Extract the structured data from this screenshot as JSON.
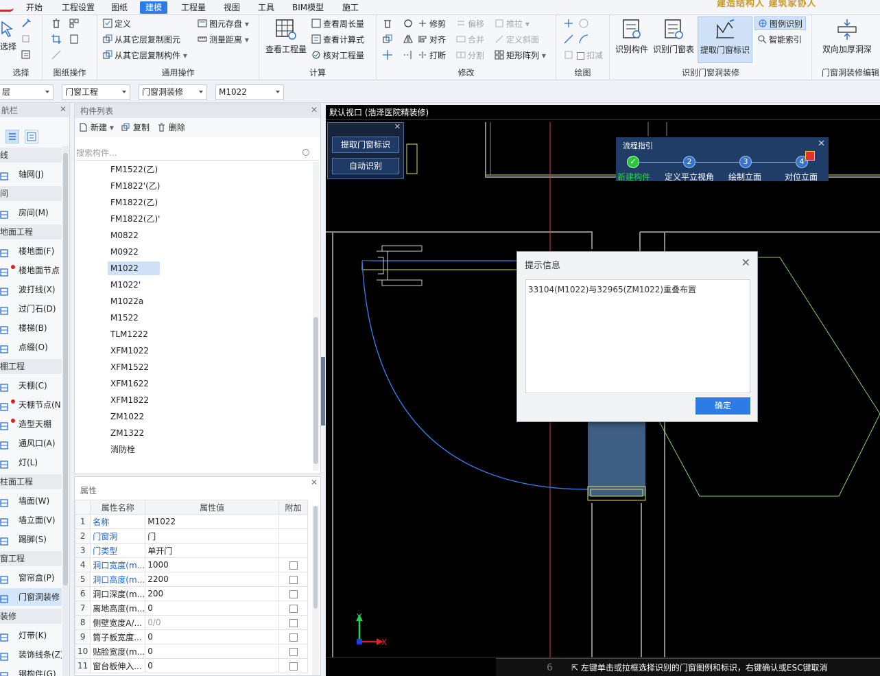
{
  "menubar": {
    "items": [
      "开始",
      "工程设置",
      "图纸",
      "建模",
      "工程量",
      "视图",
      "工具",
      "BIM模型",
      "施工"
    ],
    "active_index": 3,
    "promo": "建造结构人 建筑家协人"
  },
  "ribbon": {
    "select": {
      "caption": "选择",
      "large": "选择"
    },
    "drawing_ops": {
      "caption": "图纸操作"
    },
    "general_ops": {
      "caption": "通用操作",
      "define": "定义",
      "copy_from_floor": "从其它层复制图元",
      "copy_component": "从其它层复制构件",
      "save_element": "图元存盘",
      "measure": "测量距离"
    },
    "calc": {
      "caption": "计算",
      "view_quantity": "查看工程量",
      "view_perimeter": "查看周长量",
      "view_formula": "查看计算式",
      "check_quantity": "核对工程量"
    },
    "modify": {
      "caption": "修改",
      "trim": "修剪",
      "align": "对齐",
      "break": "打断",
      "offset": "偏移",
      "merge": "合并",
      "split": "分割",
      "push": "推拉",
      "define_slope": "定义斜面",
      "rect_array": "矩形阵列"
    },
    "draw": {
      "caption": "绘图",
      "deduct": "扣减"
    },
    "identify": {
      "caption": "识别门窗洞装修",
      "identify_component": "识别构件",
      "identify_door_table": "识别门窗表",
      "extract_door_label": "提取门窗标识",
      "legend_identify": "图例识别",
      "smart_index": "智能索引"
    },
    "opening_edit": {
      "caption": "门窗洞装修编辑",
      "double_thicken": "双向加厚洞深"
    }
  },
  "filters": [
    "层",
    "门窗工程",
    "门窗洞装修",
    "M1022"
  ],
  "nav": {
    "title": "航栏",
    "entries": [
      {
        "type": "cat",
        "label": "线"
      },
      {
        "type": "item",
        "label": "轴网(J)",
        "icon": "grid-icon"
      },
      {
        "type": "cat",
        "label": "间"
      },
      {
        "type": "item",
        "label": "房间(M)",
        "icon": "room-icon"
      },
      {
        "type": "cat",
        "label": "地面工程"
      },
      {
        "type": "item",
        "label": "楼地面(F)",
        "icon": "floor-icon"
      },
      {
        "type": "item",
        "label": "楼地面节点",
        "icon": "floor-node-icon",
        "dot": true
      },
      {
        "type": "item",
        "label": "波打线(X)",
        "icon": "border-line-icon"
      },
      {
        "type": "item",
        "label": "过门石(D)",
        "icon": "threshold-stone-icon"
      },
      {
        "type": "item",
        "label": "楼梯(B)",
        "icon": "stairs-icon"
      },
      {
        "type": "item",
        "label": "点缀(O)",
        "icon": "dot-decor-icon"
      },
      {
        "type": "cat",
        "label": "棚工程"
      },
      {
        "type": "item",
        "label": "天棚(C)",
        "icon": "ceiling-icon"
      },
      {
        "type": "item",
        "label": "天棚节点(N",
        "icon": "ceiling-node-icon",
        "dot": true
      },
      {
        "type": "item",
        "label": "造型天棚",
        "icon": "shaped-ceiling-icon",
        "dot": true
      },
      {
        "type": "item",
        "label": "通风口(A)",
        "icon": "vent-icon"
      },
      {
        "type": "item",
        "label": "灯(L)",
        "icon": "lamp-icon"
      },
      {
        "type": "cat",
        "label": "柱面工程"
      },
      {
        "type": "item",
        "label": "墙面(W)",
        "icon": "wall-face-icon"
      },
      {
        "type": "item",
        "label": "墙立面(V)",
        "icon": "wall-elevation-icon"
      },
      {
        "type": "item",
        "label": "踢脚(S)",
        "icon": "skirting-icon"
      },
      {
        "type": "cat",
        "label": "窗工程"
      },
      {
        "type": "item",
        "label": "窗帘盒(P)",
        "icon": "curtain-box-icon"
      },
      {
        "type": "item",
        "label": "门窗洞装修",
        "icon": "door-opening-icon",
        "selected": true
      },
      {
        "type": "cat",
        "label": "装修"
      },
      {
        "type": "item",
        "label": "灯带(K)",
        "icon": "light-strip-icon"
      },
      {
        "type": "item",
        "label": "装饰线条(Z)",
        "icon": "molding-icon"
      },
      {
        "type": "item",
        "label": "钢构件(G)",
        "icon": "steel-icon"
      }
    ]
  },
  "component_list": {
    "title": "构件列表",
    "new": "新建",
    "copy": "复制",
    "delete": "删除",
    "search_placeholder": "搜索构件...",
    "items": [
      "FM1522(乙)",
      "FM1822'(乙)",
      "FM1822(乙)",
      "FM1822(乙)'",
      "M0822",
      "M0922",
      "M1022",
      "M1022'",
      "M1022a",
      "M1522",
      "TLM1222",
      "XFM1022",
      "XFM1522",
      "XFM1622",
      "XFM1822",
      "ZM1022",
      "ZM1322",
      "消防栓"
    ],
    "selected": "M1022"
  },
  "properties": {
    "title": "属性",
    "headers": [
      "属性名称",
      "属性值",
      "附加"
    ],
    "rows": [
      {
        "n": "1",
        "name": "名称",
        "value": "M1022",
        "blue": true,
        "check": false
      },
      {
        "n": "2",
        "name": "门窗洞",
        "value": "门",
        "blue": true,
        "check": false
      },
      {
        "n": "3",
        "name": "门类型",
        "value": "单开门",
        "blue": true,
        "check": false
      },
      {
        "n": "4",
        "name": "洞口宽度(m...",
        "value": "1000",
        "blue": true,
        "check": true
      },
      {
        "n": "5",
        "name": "洞口高度(m...",
        "value": "2200",
        "blue": true,
        "check": true
      },
      {
        "n": "6",
        "name": "洞口深度(m...",
        "value": "200",
        "blue": false,
        "check": true
      },
      {
        "n": "7",
        "name": "离地高度(m...",
        "value": "0",
        "blue": false,
        "check": true
      },
      {
        "n": "8",
        "name": "侧壁宽度A/...",
        "value": "0/0",
        "blue": false,
        "check": true,
        "grey": true
      },
      {
        "n": "9",
        "name": "筒子板宽度...",
        "value": "0",
        "blue": false,
        "check": true
      },
      {
        "n": "10",
        "name": "贴脸宽度(m...",
        "value": "0",
        "blue": false,
        "check": true
      },
      {
        "n": "11",
        "name": "窗台板伸入...",
        "value": "0",
        "blue": false,
        "check": true
      }
    ]
  },
  "viewport": {
    "title": "默认视口 (浩泽医院精装修)",
    "float_buttons": [
      "提取门窗标识",
      "自动识别"
    ],
    "axis_y": "Y",
    "axis_x": "X"
  },
  "flow_guide": {
    "title": "流程指引",
    "steps": [
      {
        "num": "✓",
        "label": "新建构件",
        "done": true
      },
      {
        "num": "2",
        "label": "定义平立视角",
        "done": false
      },
      {
        "num": "3",
        "label": "绘制立面",
        "done": false
      },
      {
        "num": "4",
        "label": "对位立面",
        "done": false
      }
    ]
  },
  "dialog": {
    "title": "提示信息",
    "message": "33104(M1022)与32965(ZM1022)重叠布置",
    "ok": "确定"
  },
  "status": {
    "number": "6",
    "message": "左键单击或拉框选择识别的门窗图例和标识，右键确认或ESC键取消"
  },
  "colors": {
    "accent": "#2d7be5",
    "cad_blue": "#3a7ff0",
    "cad_yellow": "#d8e060",
    "cad_green": "#8ed070",
    "cad_red": "#e04040"
  }
}
